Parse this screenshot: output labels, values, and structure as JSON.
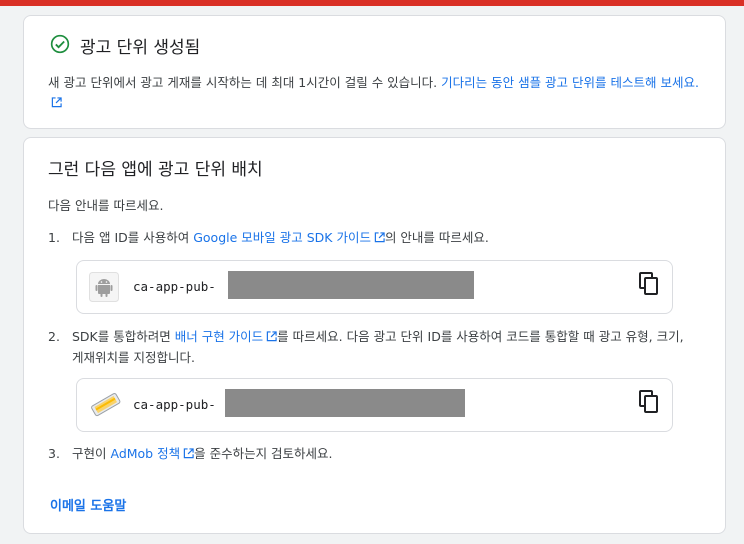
{
  "success_card": {
    "title": "광고 단위 생성됨",
    "message": "새 광고 단위에서 광고 게재를 시작하는 데 최대 1시간이 걸릴 수 있습니다.",
    "test_link": "기다리는 동안 샘플 광고 단위를 테스트해 보세요."
  },
  "placement_card": {
    "title": "그런 다음 앱에 광고 단위 배치",
    "intro": "다음 안내를 따르세요.",
    "steps": [
      {
        "num": "1.",
        "pre": "다음 앱 ID를 사용하여 ",
        "link": "Google 모바일 광고 SDK 가이드",
        "post": "의 안내를 따르세요."
      },
      {
        "num": "2.",
        "pre": "SDK를 통합하려면 ",
        "link": "배너 구현 가이드",
        "post": "를 따르세요. 다음 광고 단위 ID를 사용하여 코드를 통합할 때 광고 유형, 크기, 게재위치를 지정합니다."
      },
      {
        "num": "3.",
        "pre": "구현이 ",
        "link": "AdMob 정책",
        "post": "을 준수하는지 검토하세요."
      }
    ],
    "app_id_prefix": "ca-app-pub-",
    "ad_unit_id_prefix": "ca-app-pub-",
    "email_link": "이메일 도움말"
  },
  "colors": {
    "accent": "#1a73e8",
    "success": "#1e8e3e",
    "top_bar": "#d93025"
  },
  "icons": [
    "check-circle-icon",
    "open-in-new-icon",
    "android-icon",
    "banner-ad-icon",
    "copy-icon"
  ]
}
